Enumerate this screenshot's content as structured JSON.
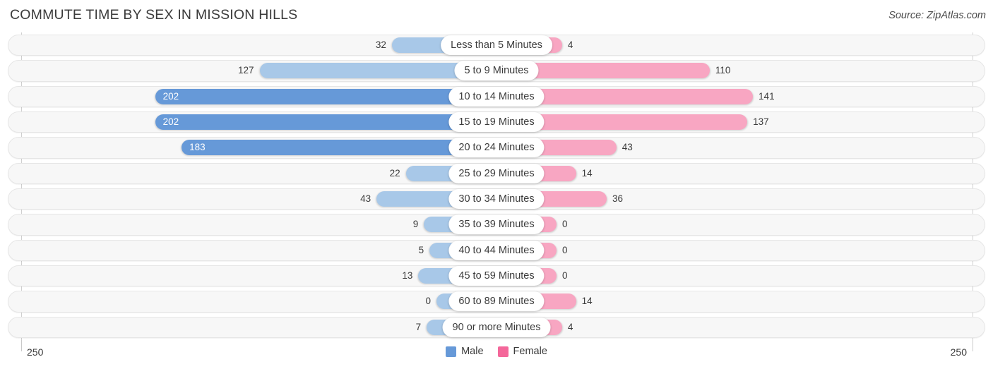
{
  "header": {
    "title": "COMMUTE TIME BY SEX IN MISSION HILLS",
    "source": "Source: ZipAtlas.com"
  },
  "axis": {
    "left_label": "250",
    "right_label": "250"
  },
  "legend": {
    "items": [
      {
        "label": "Male",
        "color": "#6699d8"
      },
      {
        "label": "Female",
        "color": "#f4679a"
      }
    ]
  },
  "colors": {
    "male_strong": "#6699d8",
    "male_light": "#a8c8e8",
    "female_strong": "#f4679a",
    "female_light": "#f8a6c2",
    "track_bg": "#f7f7f7",
    "track_border": "#e6e6e6",
    "axis": "#d0d0d0",
    "text": "#3b3b3b"
  },
  "chart_data": {
    "type": "bar",
    "subtype": "diverging-bidirectional",
    "title": "COMMUTE TIME BY SEX IN MISSION HILLS",
    "xlabel": "",
    "ylabel": "",
    "xlim": [
      250,
      250
    ],
    "axis_max": 250,
    "grid": false,
    "legend_position": "bottom-center",
    "categories": [
      "Less than 5 Minutes",
      "5 to 9 Minutes",
      "10 to 14 Minutes",
      "15 to 19 Minutes",
      "20 to 24 Minutes",
      "25 to 29 Minutes",
      "30 to 34 Minutes",
      "35 to 39 Minutes",
      "40 to 44 Minutes",
      "45 to 59 Minutes",
      "60 to 89 Minutes",
      "90 or more Minutes"
    ],
    "series": [
      {
        "name": "Male",
        "direction": "left",
        "values": [
          32,
          127,
          202,
          202,
          183,
          22,
          43,
          9,
          5,
          13,
          0,
          7
        ]
      },
      {
        "name": "Female",
        "direction": "right",
        "values": [
          4,
          110,
          141,
          137,
          43,
          14,
          36,
          0,
          0,
          0,
          14,
          4
        ]
      }
    ],
    "rows": [
      {
        "category": "Less than 5 Minutes",
        "male": 32,
        "female": 4,
        "male_label": "32",
        "female_label": "4",
        "male_inside": false,
        "female_inside": false
      },
      {
        "category": "5 to 9 Minutes",
        "male": 127,
        "female": 110,
        "male_label": "127",
        "female_label": "110",
        "male_inside": false,
        "female_inside": false
      },
      {
        "category": "10 to 14 Minutes",
        "male": 202,
        "female": 141,
        "male_label": "202",
        "female_label": "141",
        "male_inside": true,
        "female_inside": false
      },
      {
        "category": "15 to 19 Minutes",
        "male": 202,
        "female": 137,
        "male_label": "202",
        "female_label": "137",
        "male_inside": true,
        "female_inside": false
      },
      {
        "category": "20 to 24 Minutes",
        "male": 183,
        "female": 43,
        "male_label": "183",
        "female_label": "43",
        "male_inside": true,
        "female_inside": false
      },
      {
        "category": "25 to 29 Minutes",
        "male": 22,
        "female": 14,
        "male_label": "22",
        "female_label": "14",
        "male_inside": false,
        "female_inside": false
      },
      {
        "category": "30 to 34 Minutes",
        "male": 43,
        "female": 36,
        "male_label": "43",
        "female_label": "36",
        "male_inside": false,
        "female_inside": false
      },
      {
        "category": "35 to 39 Minutes",
        "male": 9,
        "female": 0,
        "male_label": "9",
        "female_label": "0",
        "male_inside": false,
        "female_inside": false
      },
      {
        "category": "40 to 44 Minutes",
        "male": 5,
        "female": 0,
        "male_label": "5",
        "female_label": "0",
        "male_inside": false,
        "female_inside": false
      },
      {
        "category": "45 to 59 Minutes",
        "male": 13,
        "female": 0,
        "male_label": "13",
        "female_label": "0",
        "male_inside": false,
        "female_inside": false
      },
      {
        "category": "60 to 89 Minutes",
        "male": 0,
        "female": 14,
        "male_label": "0",
        "female_label": "14",
        "male_inside": false,
        "female_inside": false
      },
      {
        "category": "90 or more Minutes",
        "male": 7,
        "female": 4,
        "male_label": "7",
        "female_label": "4",
        "male_inside": false,
        "female_inside": false
      }
    ]
  }
}
